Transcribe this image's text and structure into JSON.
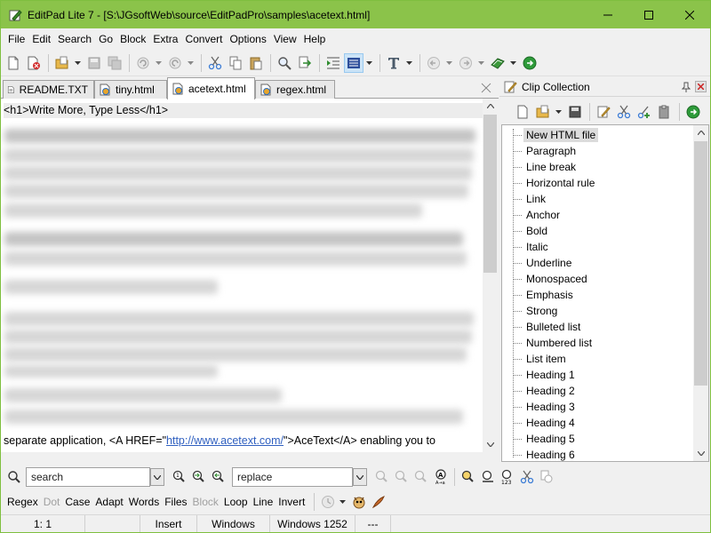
{
  "window": {
    "title": "EditPad Lite 7 - [S:\\JGsoftWeb\\source\\EditPadPro\\samples\\acetext.html]",
    "accent_color": "#8bc34a"
  },
  "menu": [
    "File",
    "Edit",
    "Search",
    "Go",
    "Block",
    "Extra",
    "Convert",
    "Options",
    "View",
    "Help"
  ],
  "toolbar": {
    "icons": [
      "new-file-icon",
      "close-file-icon",
      "open-folder-icon",
      "save-icon",
      "save-all-icon",
      "undo-icon",
      "redo-icon",
      "cut-icon",
      "copy-icon",
      "paste-icon",
      "find-icon",
      "replace-icon",
      "indent-icon",
      "block-mode-icon",
      "font-icon",
      "back-icon",
      "forward-icon",
      "clip-collection-icon",
      "run-icon"
    ]
  },
  "tabs": [
    {
      "label": "README.TXT",
      "active": false
    },
    {
      "label": "tiny.html",
      "active": false
    },
    {
      "label": "acetext.html",
      "active": true
    },
    {
      "label": "regex.html",
      "active": false
    }
  ],
  "editor": {
    "first_line": "<h1>Write More, Type Less</h1>",
    "last_line_prefix": "separate application, <A HREF=\"",
    "last_line_link": "http://www.acetext.com/",
    "last_line_suffix": "\">AceText</A> enabling you to"
  },
  "clip_panel": {
    "title": "Clip Collection",
    "items": [
      "New HTML file",
      "Paragraph",
      "Line break",
      "Horizontal rule",
      "Link",
      "Anchor",
      "Bold",
      "Italic",
      "Underline",
      "Monospaced",
      "Emphasis",
      "Strong",
      "Bulleted list",
      "Numbered list",
      "List item",
      "Heading 1",
      "Heading 2",
      "Heading 3",
      "Heading 4",
      "Heading 5",
      "Heading 6"
    ],
    "selected": "New HTML file"
  },
  "search": {
    "search_value": "search",
    "replace_value": "replace"
  },
  "options": [
    {
      "label": "Regex",
      "enabled": true
    },
    {
      "label": "Dot",
      "enabled": false
    },
    {
      "label": "Case",
      "enabled": true
    },
    {
      "label": "Adapt",
      "enabled": true
    },
    {
      "label": "Words",
      "enabled": true
    },
    {
      "label": "Files",
      "enabled": true
    },
    {
      "label": "Block",
      "enabled": false
    },
    {
      "label": "Loop",
      "enabled": true
    },
    {
      "label": "Line",
      "enabled": true
    },
    {
      "label": "Invert",
      "enabled": true
    }
  ],
  "status": {
    "position": "1: 1",
    "mode": "Insert",
    "line_break": "Windows",
    "encoding": "Windows 1252",
    "extra": "---"
  }
}
